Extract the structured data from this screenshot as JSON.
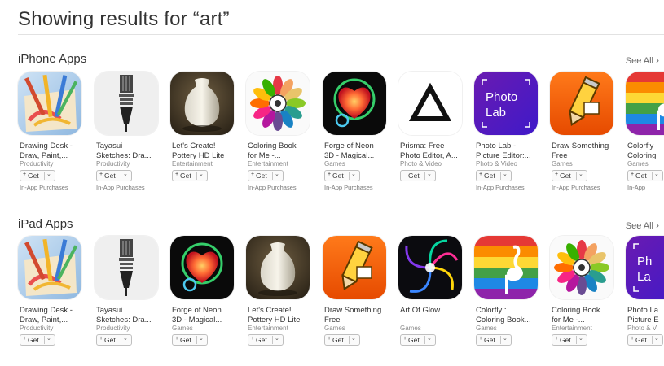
{
  "search": {
    "title": "Showing results for “art”"
  },
  "sections": [
    {
      "title": "iPhone Apps",
      "see_all": "See All",
      "apps": [
        {
          "name1": "Drawing Desk -",
          "name2": "Draw, Paint,...",
          "category": "Productivity",
          "get": "Get",
          "plus": "+",
          "iap": "In-App Purchases",
          "icon": "brushes-icon"
        },
        {
          "name1": "Tayasui",
          "name2": "Sketches: Dra...",
          "category": "Productivity",
          "get": "Get",
          "plus": "+",
          "iap": "In-App Purchases",
          "icon": "pen-nib-icon"
        },
        {
          "name1": "Let's Create!",
          "name2": "Pottery HD Lite",
          "category": "Entertainment",
          "get": "Get",
          "plus": "+",
          "iap": "",
          "icon": "vase-icon"
        },
        {
          "name1": "Coloring Book",
          "name2": "for Me -...",
          "category": "Entertainment",
          "get": "Get",
          "plus": "+",
          "iap": "In-App Purchases",
          "icon": "mandala-icon"
        },
        {
          "name1": "Forge of Neon",
          "name2": "3D - Magical...",
          "category": "Games",
          "get": "Get",
          "plus": "+",
          "iap": "In-App Purchases",
          "icon": "neon-heart-icon"
        },
        {
          "name1": "Prisma: Free",
          "name2": "Photo Editor, A...",
          "category": "Photo & Video",
          "get": "Get",
          "plus": "",
          "iap": "",
          "icon": "triangle-icon"
        },
        {
          "name1": "Photo Lab -",
          "name2": "Picture Editor:...",
          "category": "Photo & Video",
          "get": "Get",
          "plus": "+",
          "iap": "In-App Purchases",
          "icon": "photo-lab-icon"
        },
        {
          "name1": "Draw Something",
          "name2": "Free",
          "category": "Games",
          "get": "Get",
          "plus": "+",
          "iap": "In-App Purchases",
          "icon": "pencil-icon"
        },
        {
          "name1": "Colorfly",
          "name2": "Coloring",
          "category": "Games",
          "get": "Get",
          "plus": "+",
          "iap": "In-App",
          "icon": "flamingo-icon"
        }
      ]
    },
    {
      "title": "iPad Apps",
      "see_all": "See All",
      "apps": [
        {
          "name1": "Drawing Desk -",
          "name2": "Draw, Paint,...",
          "category": "Productivity",
          "get": "Get",
          "plus": "+",
          "iap": "",
          "icon": "brushes-icon"
        },
        {
          "name1": "Tayasui",
          "name2": "Sketches: Dra...",
          "category": "Productivity",
          "get": "Get",
          "plus": "+",
          "iap": "",
          "icon": "pen-nib-icon"
        },
        {
          "name1": "Forge of Neon",
          "name2": "3D - Magical...",
          "category": "Games",
          "get": "Get",
          "plus": "+",
          "iap": "",
          "icon": "neon-heart-icon"
        },
        {
          "name1": "Let's Create!",
          "name2": "Pottery HD Lite",
          "category": "Entertainment",
          "get": "Get",
          "plus": "+",
          "iap": "",
          "icon": "vase-icon"
        },
        {
          "name1": "Draw Something",
          "name2": "Free",
          "category": "Games",
          "get": "Get",
          "plus": "+",
          "iap": "",
          "icon": "pencil-icon"
        },
        {
          "name1": "Art Of Glow",
          "name2": "",
          "category": "Games",
          "get": "Get",
          "plus": "+",
          "iap": "",
          "icon": "glow-swirl-icon"
        },
        {
          "name1": "Colorfly :",
          "name2": "Coloring Book...",
          "category": "Games",
          "get": "Get",
          "plus": "+",
          "iap": "",
          "icon": "flamingo-icon"
        },
        {
          "name1": "Coloring Book",
          "name2": "for Me -...",
          "category": "Entertainment",
          "get": "Get",
          "plus": "+",
          "iap": "",
          "icon": "mandala-icon"
        },
        {
          "name1": "Photo La",
          "name2": "Picture E",
          "category": "Photo & V",
          "get": "Get",
          "plus": "+",
          "iap": "",
          "icon": "photo-lab-icon"
        }
      ]
    }
  ],
  "icon_text": {
    "photo_lab_1": "Photo",
    "photo_lab_2": "Lab",
    "photo_lab_partial_1": "Ph",
    "photo_lab_partial_2": "La"
  }
}
